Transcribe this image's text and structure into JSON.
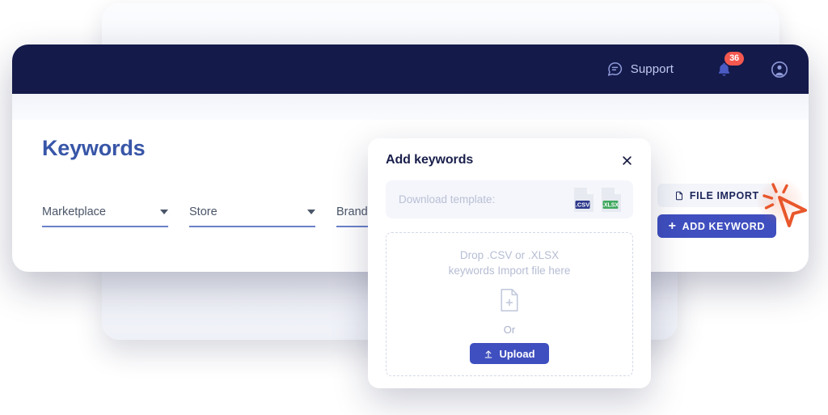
{
  "topbar": {
    "support_label": "Support",
    "support_icon": "chat-bubble-icon",
    "bell_icon": "bell-icon",
    "notification_count": "36",
    "avatar_icon": "user-avatar-icon",
    "background_color": "#141A4A"
  },
  "page": {
    "title": "Keywords",
    "title_color": "#3856A8"
  },
  "filters": [
    {
      "label": "Marketplace"
    },
    {
      "label": "Store"
    },
    {
      "label": "Brand"
    }
  ],
  "actions": {
    "file_import": {
      "label": "FILE IMPORT",
      "icon": "file-icon"
    },
    "add_keyword": {
      "label": "ADD KEYWORD",
      "icon": "plus-icon",
      "color": "#3F4FBF"
    }
  },
  "cursor": {
    "icon": "click-cursor-icon",
    "color": "#E8572B"
  },
  "modal": {
    "title": "Add keywords",
    "close_icon": "close-icon",
    "template": {
      "label": "Download template:",
      "files": [
        {
          "name": "csv-file-icon",
          "label": ".CSV",
          "color": "#2E3A8C"
        },
        {
          "name": "xlsx-file-icon",
          "label": ".XLSX",
          "color": "#41A85F"
        }
      ]
    },
    "dropzone": {
      "line1": "Drop .CSV or .XLSX",
      "line2": "keywords Import file here",
      "file_icon": "file-plus-icon",
      "or_label": "Or",
      "upload_button": {
        "label": "Upload",
        "icon": "upload-icon"
      }
    }
  }
}
